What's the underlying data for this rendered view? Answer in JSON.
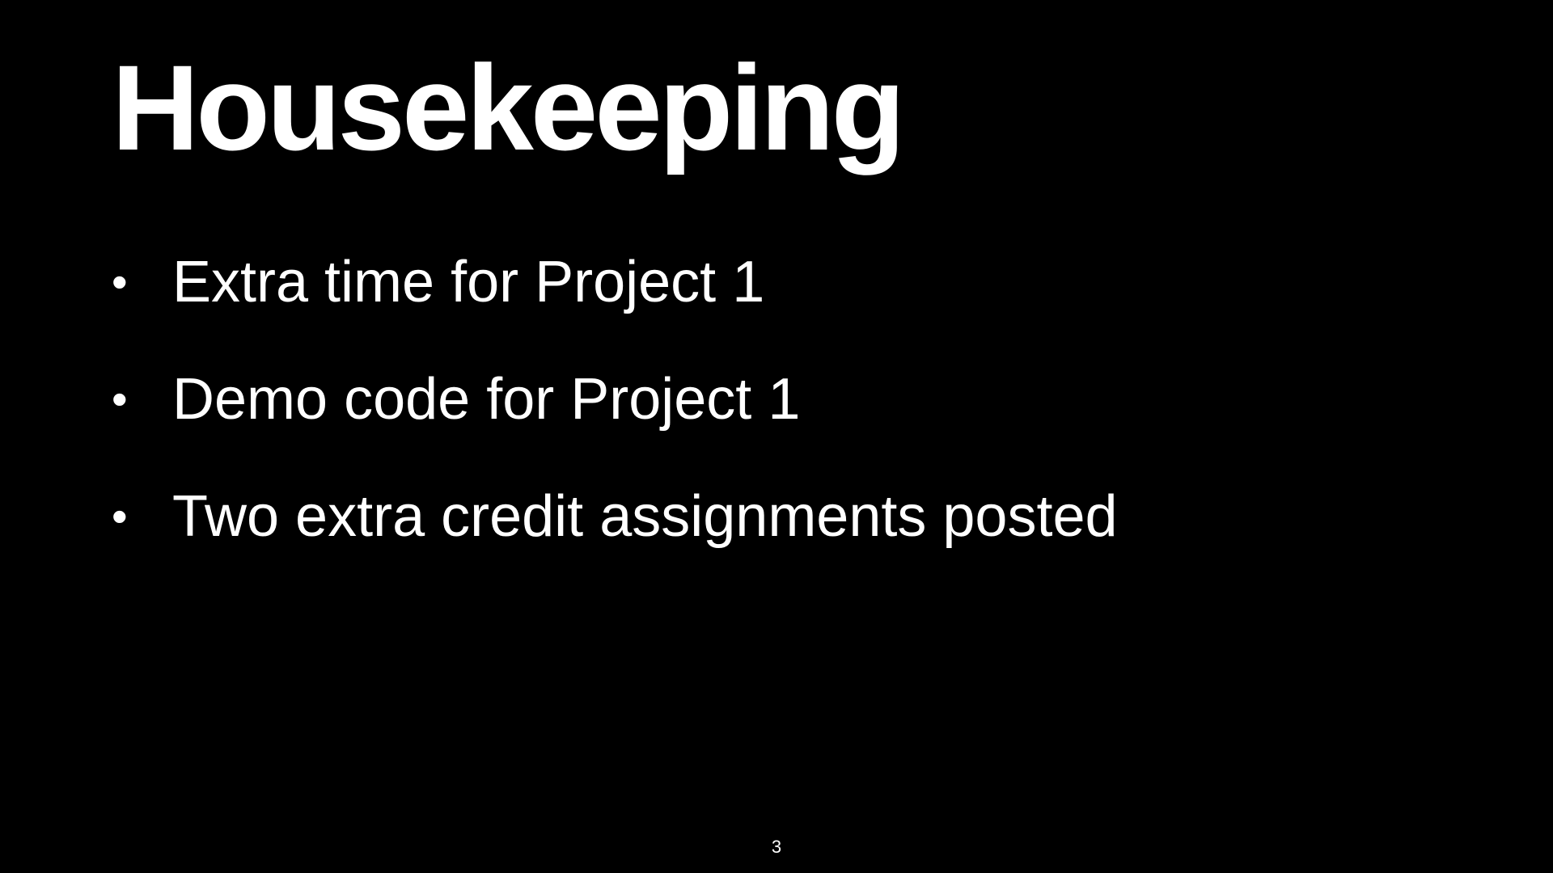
{
  "slide": {
    "title": "Housekeeping",
    "bullet_symbol": "•",
    "bullets": [
      {
        "text": "Extra time for Project 1"
      },
      {
        "text": "Demo code for Project 1"
      },
      {
        "text": "Two extra credit assignments posted"
      }
    ],
    "page_number": "3"
  },
  "colors": {
    "background": "#000000",
    "text": "#ffffff"
  }
}
